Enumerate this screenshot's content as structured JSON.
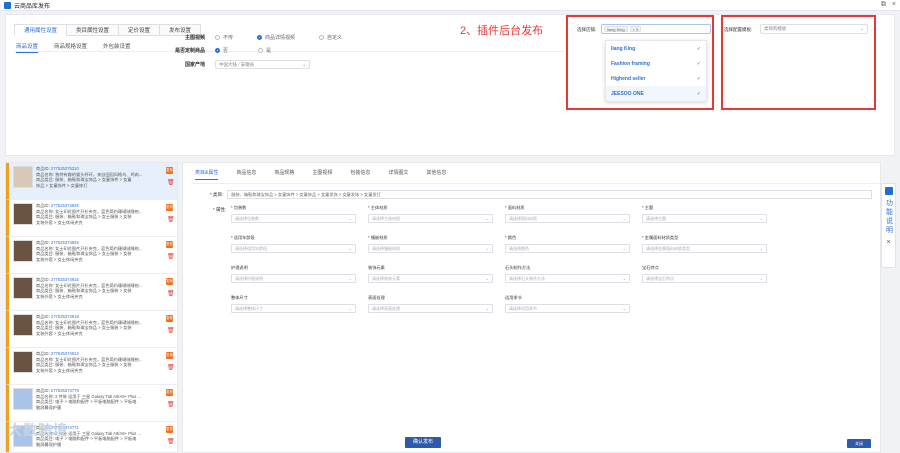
{
  "window": {
    "title": "云商品库发布",
    "close": "×",
    "restore": "⧉"
  },
  "main_tabs": [
    {
      "label": "通用属性设置",
      "active": true
    },
    {
      "label": "类目属性设置",
      "active": false
    },
    {
      "label": "定价设置",
      "active": false
    },
    {
      "label": "发布设置",
      "active": false
    }
  ],
  "sub_tabs": [
    {
      "label": "商品设置",
      "active": true
    },
    {
      "label": "商品规格设置",
      "active": false
    },
    {
      "label": "外包装设置",
      "active": false
    }
  ],
  "form": {
    "video": {
      "label": "主图视频",
      "options": [
        "不传",
        "商品详情视频",
        "自定义"
      ],
      "selected": 1
    },
    "custom": {
      "label": "是否定制商品",
      "options": [
        "否",
        "是"
      ],
      "selected": 0
    },
    "origin": {
      "label": "国家产地",
      "value": "中国大陆 / 安徽省"
    }
  },
  "annotation": "2、插件后台发布",
  "store": {
    "label": "选择店铺:",
    "tags": [
      "liang King",
      "+ 3"
    ],
    "options": [
      "liang King",
      "Fashion framing",
      "Highend seller",
      "JEESOO ONE"
    ],
    "check": "✓"
  },
  "template": {
    "label": "选择配置模板:",
    "value": "类目购模板"
  },
  "products": [
    {
      "id_label": "商品ID: ",
      "id": "277525375210",
      "name": "商品名称: 独特有趣的猫头杯环，来自田园风格鸟、鸡肉...",
      "cat": "商品类目: 服装、箱鞋和珠宝饰品 > 女童饰件 > 女童",
      "extra": "饰品 > 女童饰件 > 女童饰打",
      "badge": "发布",
      "active": true,
      "thumb": "light"
    },
    {
      "id_label": "商品ID: ",
      "id": "277525374926",
      "name": "商品名称: 女士印花图片开衫夹克，蓝色简约珊瑚绒睡袍...",
      "cat": "商品类目: 服装、箱鞋和珠宝饰品 > 女士服装 > 女装",
      "extra": "女装外套 > 女士休闲夹克",
      "badge": "发布",
      "active": false,
      "thumb": "dark"
    },
    {
      "id_label": "商品ID: ",
      "id": "277525374825",
      "name": "商品名称: 女士印花图片开衫夹克，蓝色简约珊瑚绒睡袍...",
      "cat": "商品类目: 服装、箱鞋和珠宝饰品 > 女士服装 > 女装",
      "extra": "女装外套 > 女士休闲夹克",
      "badge": "发布",
      "active": false,
      "thumb": "dark"
    },
    {
      "id_label": "商品ID: ",
      "id": "277525374915",
      "name": "商品名称: 女士印花图片开衫夹克，蓝色简约珊瑚绒睡袍...",
      "cat": "商品类目: 服装、箱鞋和珠宝饰品 > 女士服装 > 女装",
      "extra": "女装外套 > 女士休闲夹克",
      "badge": "发布",
      "active": false,
      "thumb": "dark"
    },
    {
      "id_label": "商品ID: ",
      "id": "277525374918",
      "name": "商品名称: 女士印花图片开衫夹克，蓝色简约珊瑚绒睡袍...",
      "cat": "商品类目: 服装、箱鞋和珠宝饰品 > 女士服装 > 女装",
      "extra": "女装外套 > 女士休闲夹克",
      "badge": "发布",
      "active": false,
      "thumb": "dark"
    },
    {
      "id_label": "商品ID: ",
      "id": "277525374912",
      "name": "商品名称: 女士印花图片开衫夹克，蓝色简约珊瑚绒睡袍...",
      "cat": "商品类目: 服装、箱鞋和珠宝饰品 > 女士服装 > 女装",
      "extra": "女装外套 > 女士休闲夹克",
      "badge": "发布",
      "active": false,
      "thumb": "dark"
    },
    {
      "id_label": "商品ID: ",
      "id": "277525374779",
      "name": "商品名称: 2 件装 适用于 三星 Galaxy Tab A9/A9+ Plus ...",
      "cat": "商品类目: 电子 > 电脑和配件 > 平板电脑配件 > 平板电",
      "extra": "脑屏幕保护膜",
      "badge": "发布",
      "active": false,
      "thumb": "blue"
    },
    {
      "id_label": "商品ID: ",
      "id": "277525374771",
      "name": "商品名称: 2 件装 适用于 三星 Galaxy Tab A9/A9+ Plus ...",
      "cat": "商品类目: 电子 > 电脑和配件 > 平板电脑配件 > 平板电",
      "extra": "脑屏幕保护膜",
      "badge": "发布",
      "active": false,
      "thumb": "blue"
    }
  ],
  "watermark": "大数跨境",
  "detail_tabs": [
    {
      "label": "类目&属性",
      "active": true
    },
    {
      "label": "商品信息",
      "active": false
    },
    {
      "label": "商品规格",
      "active": false
    },
    {
      "label": "主图视频",
      "active": false
    },
    {
      "label": "包装信息",
      "active": false
    },
    {
      "label": "详情图文",
      "active": false
    },
    {
      "label": "其他信息",
      "active": false
    }
  ],
  "category": {
    "label": "* 类目:",
    "value": "服装、箱鞋和珠宝饰品 > 女童饰件 > 女童饰品 > 女童发饰 > 女童发饰 > 女童发打"
  },
  "attributes": {
    "label": "* 属性:",
    "items": [
      {
        "name": "* 包装数",
        "placeholder": "请选择包装数"
      },
      {
        "name": "* 主体材质",
        "placeholder": "请选择主体材质"
      },
      {
        "name": "* 面料材质",
        "placeholder": "请选择面料材质"
      },
      {
        "name": "* 主题",
        "placeholder": "请选择主题"
      },
      {
        "name": "* 适用年龄段",
        "placeholder": "请选择适用年龄段"
      },
      {
        "name": "* 镶嵌材质",
        "placeholder": "请选择镶嵌材质"
      },
      {
        "name": "* 颜色",
        "placeholder": "请选择颜色"
      },
      {
        "name": "* 金属面料材质类型",
        "placeholder": "请选择金属面料材质类型"
      },
      {
        "name": "护理说明",
        "placeholder": "请选择护理说明"
      },
      {
        "name": "装饰元素",
        "placeholder": "请选择装饰元素"
      },
      {
        "name": "石头制作方法",
        "placeholder": "请选择石头制作方法"
      },
      {
        "name": "宝石特点",
        "placeholder": "请选择宝石特点"
      },
      {
        "name": "整体尺寸",
        "placeholder": "请选择整体尺寸"
      },
      {
        "name": "表面处理",
        "placeholder": "请选择表面处理"
      },
      {
        "name": "适用季节",
        "placeholder": "请选择适用季节"
      }
    ]
  },
  "buttons": {
    "confirm": "确认发布",
    "close": "关闭"
  },
  "help": {
    "text": "功能说明",
    "close": "×"
  },
  "icons": {
    "dropdown": "⌄",
    "trash": "🗑"
  }
}
